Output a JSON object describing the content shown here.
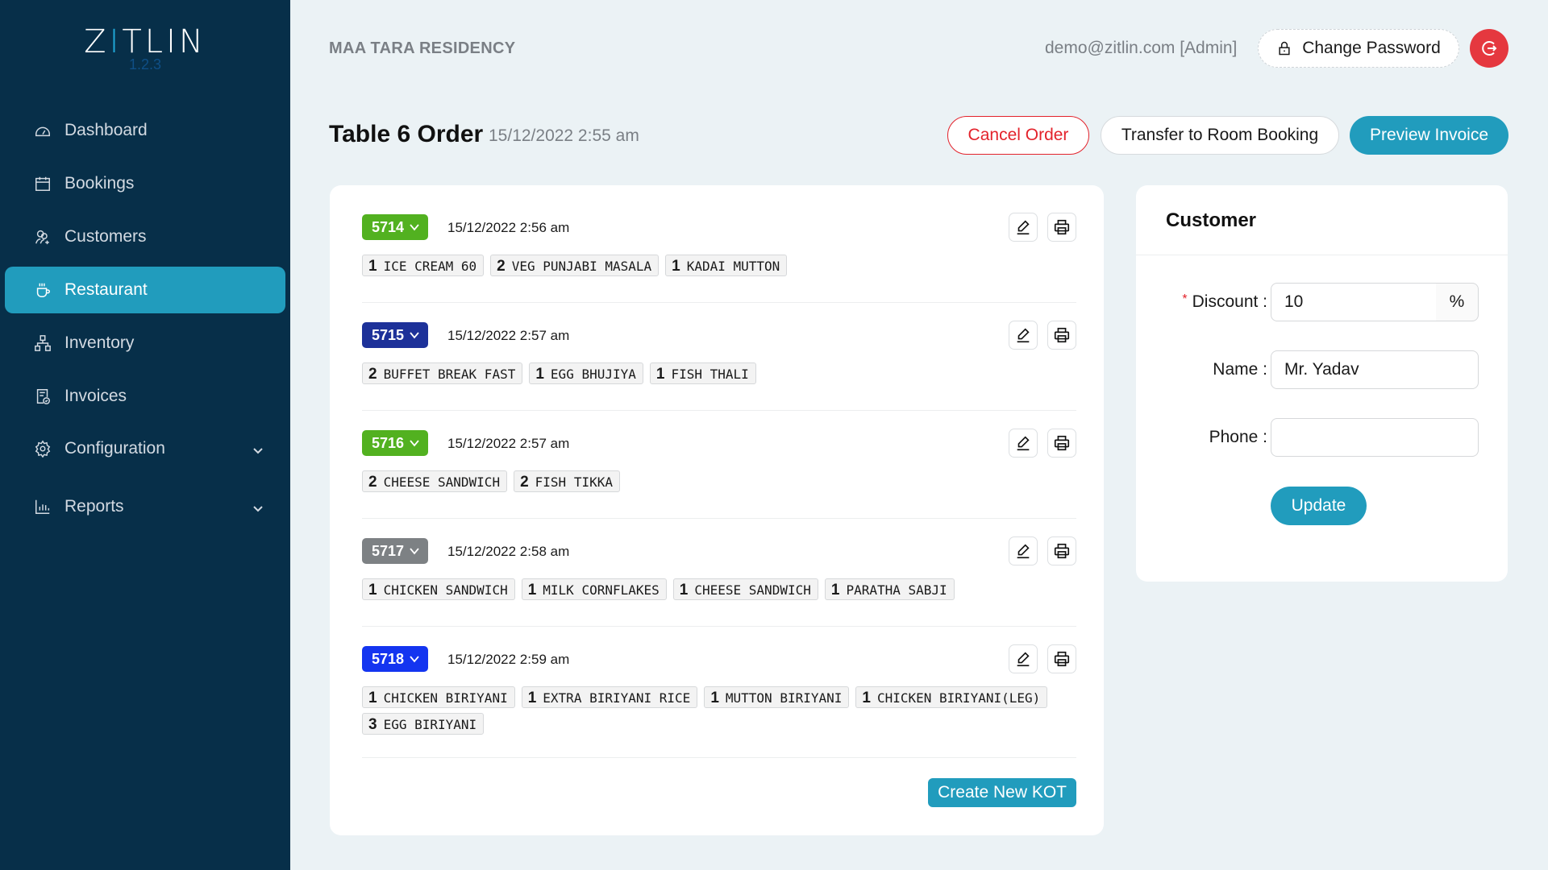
{
  "app": {
    "logo": "ZITLIN",
    "version": "1.2.3"
  },
  "sidebar": {
    "items": [
      {
        "label": "Dashboard",
        "icon": "dashboard-gauge-icon",
        "active": false
      },
      {
        "label": "Bookings",
        "icon": "calendar-icon",
        "active": false
      },
      {
        "label": "Customers",
        "icon": "users-add-icon",
        "active": false
      },
      {
        "label": "Restaurant",
        "icon": "coffee-cup-icon",
        "active": true
      },
      {
        "label": "Inventory",
        "icon": "hierarchy-icon",
        "active": false
      },
      {
        "label": "Invoices",
        "icon": "invoice-check-icon",
        "active": false
      },
      {
        "label": "Configuration",
        "icon": "gear-icon",
        "active": false,
        "expandable": true
      },
      {
        "label": "Reports",
        "icon": "bar-chart-icon",
        "active": false,
        "expandable": true
      }
    ]
  },
  "header": {
    "hotel_name": "MAA TARA RESIDENCY",
    "user": "demo@zitlin.com [Admin]",
    "change_password_label": "Change Password"
  },
  "page": {
    "title": "Table 6 Order",
    "date": "15/12/2022 2:55 am",
    "actions": {
      "cancel": "Cancel Order",
      "transfer": "Transfer to Room Booking",
      "preview": "Preview Invoice"
    }
  },
  "colors": {
    "accent": "#219cbd",
    "danger": "#e3222b",
    "sidebar_bg": "#072f49",
    "badge_green": "#52b120",
    "badge_navy": "#1d3199",
    "badge_gray": "#7d8184",
    "badge_blue": "#1435f0"
  },
  "kots": [
    {
      "number": "5714",
      "color": "#52b120",
      "time": "15/12/2022 2:56 am",
      "items": [
        {
          "qty": "1",
          "name": "ICE CREAM 60"
        },
        {
          "qty": "2",
          "name": "VEG PUNJABI MASALA"
        },
        {
          "qty": "1",
          "name": "KADAI MUTTON"
        }
      ]
    },
    {
      "number": "5715",
      "color": "#1d3199",
      "time": "15/12/2022 2:57 am",
      "items": [
        {
          "qty": "2",
          "name": "BUFFET BREAK FAST"
        },
        {
          "qty": "1",
          "name": "EGG BHUJIYA"
        },
        {
          "qty": "1",
          "name": "FISH THALI"
        }
      ]
    },
    {
      "number": "5716",
      "color": "#52b120",
      "time": "15/12/2022 2:57 am",
      "items": [
        {
          "qty": "2",
          "name": "CHEESE SANDWICH"
        },
        {
          "qty": "2",
          "name": "FISH TIKKA"
        }
      ]
    },
    {
      "number": "5717",
      "color": "#7d8184",
      "time": "15/12/2022 2:58 am",
      "items": [
        {
          "qty": "1",
          "name": "CHICKEN SANDWICH"
        },
        {
          "qty": "1",
          "name": "MILK CORNFLAKES"
        },
        {
          "qty": "1",
          "name": "CHEESE SANDWICH"
        },
        {
          "qty": "1",
          "name": "PARATHA SABJI"
        }
      ]
    },
    {
      "number": "5718",
      "color": "#1435f0",
      "time": "15/12/2022 2:59 am",
      "items": [
        {
          "qty": "1",
          "name": "CHICKEN BIRIYANI"
        },
        {
          "qty": "1",
          "name": "EXTRA BIRIYANI RICE"
        },
        {
          "qty": "1",
          "name": "MUTTON BIRIYANI"
        },
        {
          "qty": "1",
          "name": "CHICKEN BIRIYANI(LEG)"
        },
        {
          "qty": "3",
          "name": "EGG BIRIYANI"
        }
      ]
    }
  ],
  "create_kot_label": "Create New KOT",
  "customer": {
    "title": "Customer",
    "discount_label": "Discount",
    "discount_value": "10",
    "discount_unit": "%",
    "name_label": "Name",
    "name_value": "Mr. Yadav",
    "phone_label": "Phone",
    "phone_value": "",
    "update_label": "Update"
  }
}
